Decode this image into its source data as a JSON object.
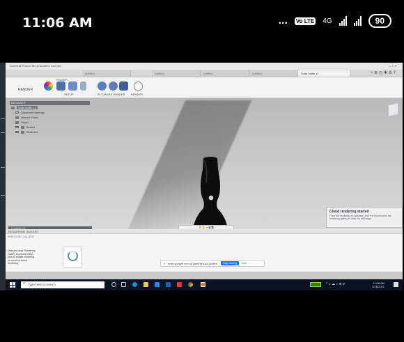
{
  "phone_status": {
    "time": "11:06 AM",
    "volte": "Vo LTE",
    "network": "4G",
    "battery": "90",
    "dots": "..."
  },
  "window": {
    "title": "Autodesk Fusion 360 (Education License)"
  },
  "tabs": [
    {
      "label": "Untitled"
    },
    {
      "label": "Untitled"
    },
    {
      "label": "Untitled"
    },
    {
      "label": "Untitled"
    },
    {
      "label": "Soda bottle v1"
    }
  ],
  "toolbar": {
    "workspace": "RENDER",
    "section_render": "RENDER",
    "setup": "SETUP",
    "in_canvas_render": "IN-CANVAS RENDER",
    "render": "RENDER"
  },
  "browser": {
    "header": "BROWSER",
    "items": [
      {
        "label": "Soda bottle v1"
      },
      {
        "label": "Document Settings"
      },
      {
        "label": "Named Views"
      },
      {
        "label": "Origin"
      },
      {
        "label": "Bodies"
      },
      {
        "label": "Sketches"
      }
    ]
  },
  "comments_label": "COMMENTS",
  "cloud_notice": {
    "title": "Cloud rendering started",
    "body": "Once the rendering is complete, click the thumbnail in the rendering gallery to view the full image."
  },
  "gallery": {
    "header": "RENDERING GALLERY",
    "subheader": "RENDERING GALLERY",
    "description": "Drag and drop Rendering Gallery thumbnail views here to enable rendering on cloud for future rendering."
  },
  "share_banner": {
    "text": "meet.google.com is sharing your screen.",
    "stop_label": "Stop sharing",
    "hide_label": "Hide"
  },
  "taskbar": {
    "search_placeholder": "Type here to search",
    "time": "11:06 AM",
    "date": "4/26/2021"
  }
}
